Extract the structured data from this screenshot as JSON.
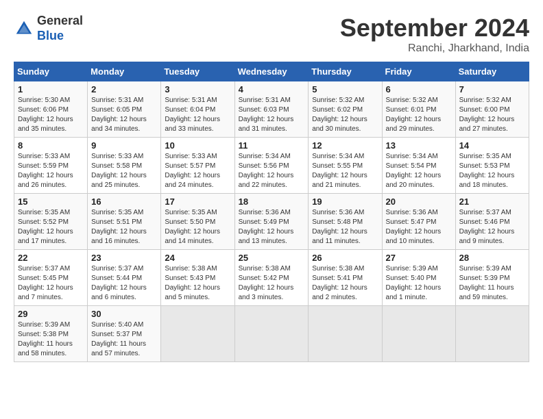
{
  "header": {
    "logo_line1": "General",
    "logo_line2": "Blue",
    "month": "September 2024",
    "location": "Ranchi, Jharkhand, India"
  },
  "weekdays": [
    "Sunday",
    "Monday",
    "Tuesday",
    "Wednesday",
    "Thursday",
    "Friday",
    "Saturday"
  ],
  "weeks": [
    [
      {
        "day": "1",
        "info": "Sunrise: 5:30 AM\nSunset: 6:06 PM\nDaylight: 12 hours\nand 35 minutes."
      },
      {
        "day": "2",
        "info": "Sunrise: 5:31 AM\nSunset: 6:05 PM\nDaylight: 12 hours\nand 34 minutes."
      },
      {
        "day": "3",
        "info": "Sunrise: 5:31 AM\nSunset: 6:04 PM\nDaylight: 12 hours\nand 33 minutes."
      },
      {
        "day": "4",
        "info": "Sunrise: 5:31 AM\nSunset: 6:03 PM\nDaylight: 12 hours\nand 31 minutes."
      },
      {
        "day": "5",
        "info": "Sunrise: 5:32 AM\nSunset: 6:02 PM\nDaylight: 12 hours\nand 30 minutes."
      },
      {
        "day": "6",
        "info": "Sunrise: 5:32 AM\nSunset: 6:01 PM\nDaylight: 12 hours\nand 29 minutes."
      },
      {
        "day": "7",
        "info": "Sunrise: 5:32 AM\nSunset: 6:00 PM\nDaylight: 12 hours\nand 27 minutes."
      }
    ],
    [
      {
        "day": "8",
        "info": "Sunrise: 5:33 AM\nSunset: 5:59 PM\nDaylight: 12 hours\nand 26 minutes."
      },
      {
        "day": "9",
        "info": "Sunrise: 5:33 AM\nSunset: 5:58 PM\nDaylight: 12 hours\nand 25 minutes."
      },
      {
        "day": "10",
        "info": "Sunrise: 5:33 AM\nSunset: 5:57 PM\nDaylight: 12 hours\nand 24 minutes."
      },
      {
        "day": "11",
        "info": "Sunrise: 5:34 AM\nSunset: 5:56 PM\nDaylight: 12 hours\nand 22 minutes."
      },
      {
        "day": "12",
        "info": "Sunrise: 5:34 AM\nSunset: 5:55 PM\nDaylight: 12 hours\nand 21 minutes."
      },
      {
        "day": "13",
        "info": "Sunrise: 5:34 AM\nSunset: 5:54 PM\nDaylight: 12 hours\nand 20 minutes."
      },
      {
        "day": "14",
        "info": "Sunrise: 5:35 AM\nSunset: 5:53 PM\nDaylight: 12 hours\nand 18 minutes."
      }
    ],
    [
      {
        "day": "15",
        "info": "Sunrise: 5:35 AM\nSunset: 5:52 PM\nDaylight: 12 hours\nand 17 minutes."
      },
      {
        "day": "16",
        "info": "Sunrise: 5:35 AM\nSunset: 5:51 PM\nDaylight: 12 hours\nand 16 minutes."
      },
      {
        "day": "17",
        "info": "Sunrise: 5:35 AM\nSunset: 5:50 PM\nDaylight: 12 hours\nand 14 minutes."
      },
      {
        "day": "18",
        "info": "Sunrise: 5:36 AM\nSunset: 5:49 PM\nDaylight: 12 hours\nand 13 minutes."
      },
      {
        "day": "19",
        "info": "Sunrise: 5:36 AM\nSunset: 5:48 PM\nDaylight: 12 hours\nand 11 minutes."
      },
      {
        "day": "20",
        "info": "Sunrise: 5:36 AM\nSunset: 5:47 PM\nDaylight: 12 hours\nand 10 minutes."
      },
      {
        "day": "21",
        "info": "Sunrise: 5:37 AM\nSunset: 5:46 PM\nDaylight: 12 hours\nand 9 minutes."
      }
    ],
    [
      {
        "day": "22",
        "info": "Sunrise: 5:37 AM\nSunset: 5:45 PM\nDaylight: 12 hours\nand 7 minutes."
      },
      {
        "day": "23",
        "info": "Sunrise: 5:37 AM\nSunset: 5:44 PM\nDaylight: 12 hours\nand 6 minutes."
      },
      {
        "day": "24",
        "info": "Sunrise: 5:38 AM\nSunset: 5:43 PM\nDaylight: 12 hours\nand 5 minutes."
      },
      {
        "day": "25",
        "info": "Sunrise: 5:38 AM\nSunset: 5:42 PM\nDaylight: 12 hours\nand 3 minutes."
      },
      {
        "day": "26",
        "info": "Sunrise: 5:38 AM\nSunset: 5:41 PM\nDaylight: 12 hours\nand 2 minutes."
      },
      {
        "day": "27",
        "info": "Sunrise: 5:39 AM\nSunset: 5:40 PM\nDaylight: 12 hours\nand 1 minute."
      },
      {
        "day": "28",
        "info": "Sunrise: 5:39 AM\nSunset: 5:39 PM\nDaylight: 11 hours\nand 59 minutes."
      }
    ],
    [
      {
        "day": "29",
        "info": "Sunrise: 5:39 AM\nSunset: 5:38 PM\nDaylight: 11 hours\nand 58 minutes."
      },
      {
        "day": "30",
        "info": "Sunrise: 5:40 AM\nSunset: 5:37 PM\nDaylight: 11 hours\nand 57 minutes."
      },
      {
        "day": "",
        "info": ""
      },
      {
        "day": "",
        "info": ""
      },
      {
        "day": "",
        "info": ""
      },
      {
        "day": "",
        "info": ""
      },
      {
        "day": "",
        "info": ""
      }
    ]
  ]
}
